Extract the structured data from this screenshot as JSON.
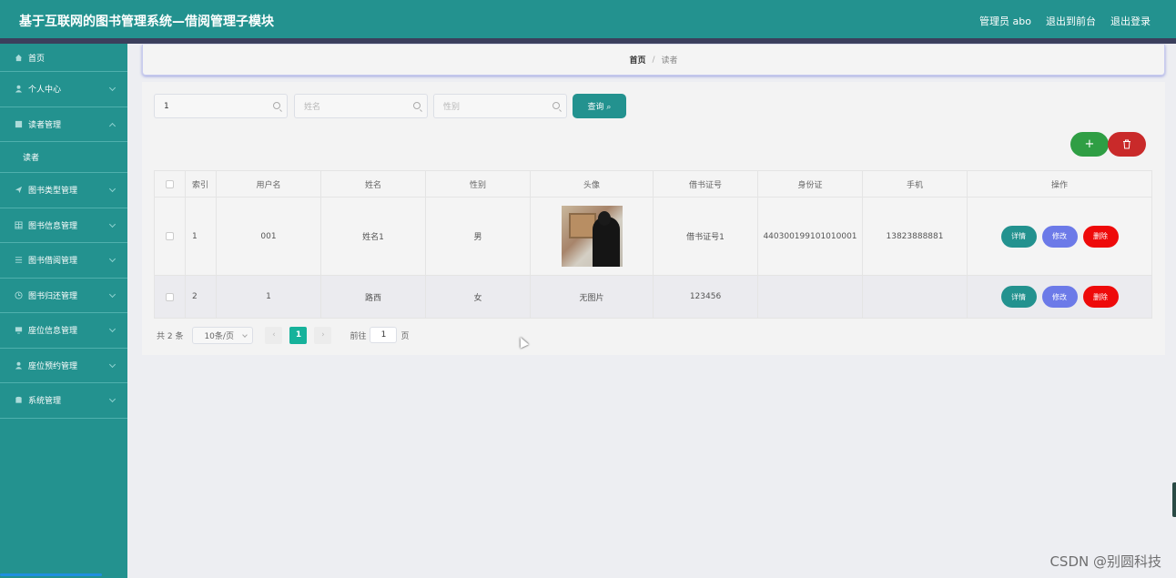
{
  "header": {
    "title": "基于互联网的图书管理系统—借阅管理子模块",
    "links": [
      "管理员 abo",
      "退出到前台",
      "退出登录"
    ]
  },
  "sidebar": {
    "items": [
      {
        "label": "首页",
        "icon": "home-icon"
      },
      {
        "label": "个人中心",
        "icon": "user-icon"
      },
      {
        "label": "读者管理",
        "icon": "grid-icon",
        "expanded": true,
        "children": [
          "读者"
        ]
      },
      {
        "label": "图书类型管理",
        "icon": "send-icon"
      },
      {
        "label": "图书信息管理",
        "icon": "table-icon"
      },
      {
        "label": "图书借阅管理",
        "icon": "sliders-icon"
      },
      {
        "label": "图书归还管理",
        "icon": "clock-icon"
      },
      {
        "label": "座位信息管理",
        "icon": "monitor-icon"
      },
      {
        "label": "座位预约管理",
        "icon": "user-icon"
      },
      {
        "label": "系统管理",
        "icon": "database-icon"
      }
    ]
  },
  "breadcrumb": {
    "home": "首页",
    "sep": "/",
    "current": "读者"
  },
  "search": {
    "username_value": "1",
    "name_placeholder": "姓名",
    "gender_placeholder": "性别",
    "query_label": "查询 ⌕"
  },
  "actions": {
    "add_label": "+",
    "delete_label": "🗑"
  },
  "table": {
    "headers": [
      "索引",
      "用户名",
      "姓名",
      "性别",
      "头像",
      "借书证号",
      "身份证",
      "手机",
      "操作"
    ],
    "rows": [
      {
        "index": "1",
        "username": "001",
        "name": "姓名1",
        "gender": "男",
        "avatar": "",
        "card": "借书证号1",
        "idcard": "440300199101010001",
        "phone": "13823888881"
      },
      {
        "index": "2",
        "username": "1",
        "name": "路西",
        "gender": "女",
        "avatar": "无图片",
        "card": "123456",
        "idcard": "",
        "phone": ""
      }
    ],
    "ops": {
      "detail": "详情",
      "edit": "修改",
      "delete": "删除"
    }
  },
  "pagination": {
    "total": "共 2 条",
    "page_size": "10条/页",
    "prev": "‹",
    "current": "1",
    "next": "›",
    "goto_label": "前往",
    "goto_value": "1",
    "page_suffix": "页"
  },
  "watermark": "CSDN @别圆科技",
  "colors": {
    "primary": "#23928f",
    "edit": "#6c7ae8",
    "danger": "#ee0a0a",
    "add": "#2f9e44"
  }
}
